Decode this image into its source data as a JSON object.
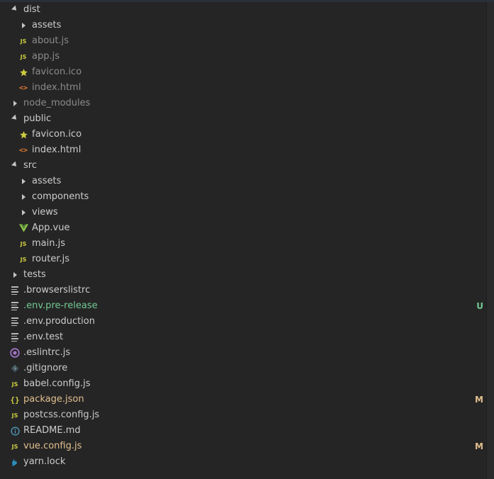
{
  "explorer": {
    "items": [
      {
        "label": "dist",
        "type": "folder-open",
        "indent": 0,
        "color": "#cccccc"
      },
      {
        "label": "assets",
        "type": "folder-closed",
        "indent": 1,
        "color": "#cccccc"
      },
      {
        "label": "about.js",
        "type": "js",
        "indent": 1,
        "color": "#8b8b8b"
      },
      {
        "label": "app.js",
        "type": "js",
        "indent": 1,
        "color": "#8b8b8b"
      },
      {
        "label": "favicon.ico",
        "type": "favicon",
        "indent": 1,
        "color": "#8b8b8b"
      },
      {
        "label": "index.html",
        "type": "html",
        "indent": 1,
        "color": "#8b8b8b"
      },
      {
        "label": "node_modules",
        "type": "folder-closed",
        "indent": 0,
        "color": "#8b8b8b"
      },
      {
        "label": "public",
        "type": "folder-open",
        "indent": 0,
        "color": "#cccccc"
      },
      {
        "label": "favicon.ico",
        "type": "favicon",
        "indent": 1,
        "color": "#cccccc"
      },
      {
        "label": "index.html",
        "type": "html",
        "indent": 1,
        "color": "#cccccc"
      },
      {
        "label": "src",
        "type": "folder-open",
        "indent": 0,
        "color": "#cccccc"
      },
      {
        "label": "assets",
        "type": "folder-closed",
        "indent": 1,
        "color": "#cccccc"
      },
      {
        "label": "components",
        "type": "folder-closed",
        "indent": 1,
        "color": "#cccccc"
      },
      {
        "label": "views",
        "type": "folder-closed",
        "indent": 1,
        "color": "#cccccc"
      },
      {
        "label": "App.vue",
        "type": "vue",
        "indent": 1,
        "color": "#cccccc"
      },
      {
        "label": "main.js",
        "type": "js",
        "indent": 1,
        "color": "#cccccc"
      },
      {
        "label": "router.js",
        "type": "js",
        "indent": 1,
        "color": "#cccccc"
      },
      {
        "label": "tests",
        "type": "folder-closed",
        "indent": 0,
        "color": "#cccccc"
      },
      {
        "label": ".browserslistrc",
        "type": "lines",
        "indent": 0,
        "color": "#cccccc"
      },
      {
        "label": ".env.pre-release",
        "type": "lines",
        "indent": 0,
        "color": "#73c991",
        "badge": "U",
        "badge_color": "#73c991"
      },
      {
        "label": ".env.production",
        "type": "lines",
        "indent": 0,
        "color": "#cccccc"
      },
      {
        "label": ".env.test",
        "type": "lines",
        "indent": 0,
        "color": "#cccccc"
      },
      {
        "label": ".eslintrc.js",
        "type": "eslint",
        "indent": 0,
        "color": "#cccccc"
      },
      {
        "label": ".gitignore",
        "type": "git",
        "indent": 0,
        "color": "#cccccc"
      },
      {
        "label": "babel.config.js",
        "type": "js",
        "indent": 0,
        "color": "#cccccc"
      },
      {
        "label": "package.json",
        "type": "json",
        "indent": 0,
        "color": "#e2c08d",
        "badge": "M",
        "badge_color": "#e2c08d"
      },
      {
        "label": "postcss.config.js",
        "type": "js",
        "indent": 0,
        "color": "#cccccc"
      },
      {
        "label": "README.md",
        "type": "info",
        "indent": 0,
        "color": "#cccccc"
      },
      {
        "label": "vue.config.js",
        "type": "js",
        "indent": 0,
        "color": "#e2c08d",
        "badge": "M",
        "badge_color": "#e2c08d"
      },
      {
        "label": "yarn.lock",
        "type": "yarn",
        "indent": 0,
        "color": "#cccccc"
      }
    ]
  }
}
